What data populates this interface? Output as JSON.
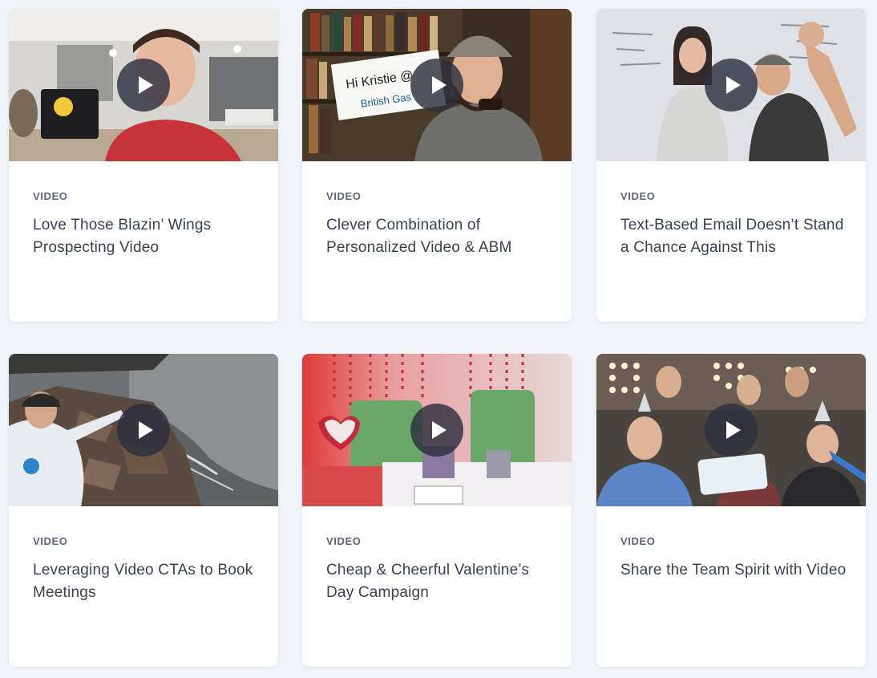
{
  "cards": [
    {
      "tag": "VIDEO",
      "title": "Love Those Blazin’ Wings Prospecting Video",
      "thumbnail": "man-holding-wings-box-in-office"
    },
    {
      "tag": "VIDEO",
      "title": "Clever Combination of Personalized Video & ABM",
      "thumbnail": "man-in-deerstalker-hat-with-pipe"
    },
    {
      "tag": "VIDEO",
      "title": "Text-Based Email Doesn’t Stand a Chance Against This",
      "thumbnail": "two-people-waving-at-whiteboard"
    },
    {
      "tag": "VIDEO",
      "title": "Leveraging Video CTAs to Book Meetings",
      "thumbnail": "man-on-rocks-by-water"
    },
    {
      "tag": "VIDEO",
      "title": "Cheap & Cheerful Valentine’s Day Campaign",
      "thumbnail": "valentine-decorated-office"
    },
    {
      "tag": "VIDEO",
      "title": "Share the Team Spirit with Video",
      "thumbnail": "team-with-party-hats-and-sign"
    }
  ],
  "thumb_text": {
    "sign_1": "Hi Kristie @",
    "sign_2": "British Gas"
  },
  "colors": {
    "page_background": "#f0f4fa",
    "card_background": "#ffffff",
    "tag_text": "#5c6479",
    "title_text": "#3b4153",
    "play_button": "#2d303e"
  }
}
